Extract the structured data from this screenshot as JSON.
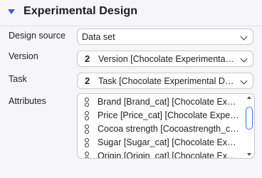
{
  "section": {
    "title": "Experimental Design",
    "collapse_icon": "triangle-down-icon",
    "accent_color": "#3a62d8"
  },
  "fields": {
    "design_source": {
      "label": "Design source",
      "value": "Data set"
    },
    "version": {
      "label": "Version",
      "number": "2",
      "value": "Version [Chocolate Experimental Design]"
    },
    "task": {
      "label": "Task",
      "number": "2",
      "value": "Task [Chocolate Experimental Design]"
    },
    "attributes": {
      "label": "Attributes",
      "items": [
        {
          "label": "Brand [Brand_cat] [Chocolate Experimental Design]",
          "icon": "categorical-variable-icon"
        },
        {
          "label": "Price [Price_cat] [Chocolate Experimental Design]",
          "icon": "categorical-variable-icon"
        },
        {
          "label": "Cocoa strength [Cocoastrength_cat] [Chocolate Experimental Design]",
          "icon": "categorical-variable-icon"
        },
        {
          "label": "Sugar [Sugar_cat] [Chocolate Experimental Design]",
          "icon": "categorical-variable-icon"
        },
        {
          "label": "Origin [Origin_cat] [Chocolate Experimental Design]",
          "icon": "categorical-variable-icon"
        }
      ]
    }
  }
}
